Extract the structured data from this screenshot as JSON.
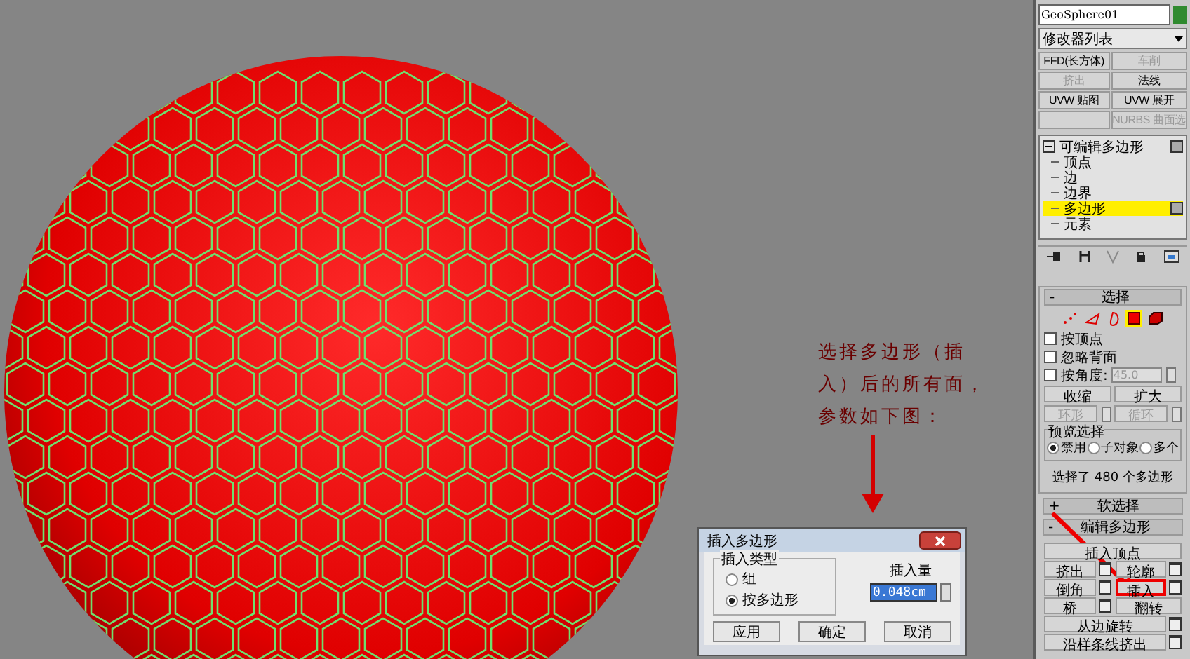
{
  "object_name": "GeoSphere01",
  "modifier_list": "修改器列表",
  "modifier_buttons": [
    {
      "label": "FFD(长方体)",
      "disabled": false
    },
    {
      "label": "车削",
      "disabled": true
    },
    {
      "label": "挤出",
      "disabled": true
    },
    {
      "label": "法线",
      "disabled": false
    },
    {
      "label": "UVW 贴图",
      "disabled": false
    },
    {
      "label": "UVW 展开",
      "disabled": false
    },
    {
      "label": "NURBS 曲面选",
      "disabled": true
    }
  ],
  "stack": [
    {
      "label": "可编辑多边形",
      "expanded": true,
      "selected": false,
      "children": [
        {
          "label": "顶点",
          "selected": false
        },
        {
          "label": "边",
          "selected": false
        },
        {
          "label": "边界",
          "selected": false
        },
        {
          "label": "多边形",
          "selected": true
        },
        {
          "label": "元素",
          "selected": false
        }
      ]
    }
  ],
  "selection": {
    "sign": "-",
    "title": "选择",
    "levels": [
      {
        "kind": "vertex",
        "selected": false
      },
      {
        "kind": "edge",
        "selected": false
      },
      {
        "kind": "border",
        "selected": false
      },
      {
        "kind": "polygon",
        "selected": true
      },
      {
        "kind": "element",
        "selected": false
      }
    ],
    "checkboxes": [
      {
        "label": "按顶点",
        "checked": false
      },
      {
        "label": "忽略背面",
        "checked": false
      },
      {
        "label": "按角度:",
        "checked": false,
        "value": "45.0"
      }
    ],
    "buttons": [
      {
        "label": "收缩",
        "disabled": false
      },
      {
        "label": "扩大",
        "disabled": false
      }
    ],
    "spin_buttons": [
      {
        "label": "环形",
        "disabled": true
      },
      {
        "label": "循环",
        "disabled": true
      }
    ],
    "preview": {
      "title": "预览选择",
      "options": [
        {
          "label": "禁用",
          "selected": true
        },
        {
          "label": "子对象",
          "selected": false
        },
        {
          "label": "多个",
          "selected": false
        }
      ]
    },
    "status": "选择了 480 个多边形"
  },
  "rollouts": [
    {
      "sign": "+",
      "title": "软选择"
    },
    {
      "sign": "-",
      "title": "编辑多边形"
    }
  ],
  "edit_buttons": [
    {
      "kind": "wide",
      "label": "插入顶点",
      "settings": false,
      "highlighted": false
    },
    {
      "kind": "half",
      "label": "挤出",
      "settings": true,
      "highlighted": false
    },
    {
      "kind": "half",
      "label": "轮廓",
      "settings": true,
      "highlighted": false
    },
    {
      "kind": "half",
      "label": "倒角",
      "settings": true,
      "highlighted": false
    },
    {
      "kind": "half",
      "label": "插入",
      "settings": true,
      "highlighted": true
    },
    {
      "kind": "half",
      "label": "桥",
      "settings": true,
      "highlighted": false
    },
    {
      "kind": "half",
      "label": "翻转",
      "settings": false,
      "highlighted": false
    },
    {
      "kind": "wide",
      "label": "从边旋转",
      "settings": true,
      "highlighted": false
    },
    {
      "kind": "wide",
      "label": "沿样条线挤出",
      "settings": true,
      "highlighted": false
    }
  ],
  "annotation": "选择多边形（插入）后的所有面，参数如下图：",
  "dialog": {
    "title": "插入多边形",
    "group": "插入类型",
    "options": [
      {
        "label": "组",
        "selected": false
      },
      {
        "label": "按多边形",
        "selected": true
      }
    ],
    "amount_label": "插入量",
    "amount_value": "0.048cm",
    "buttons": [
      "应用",
      "确定",
      "取消"
    ]
  }
}
